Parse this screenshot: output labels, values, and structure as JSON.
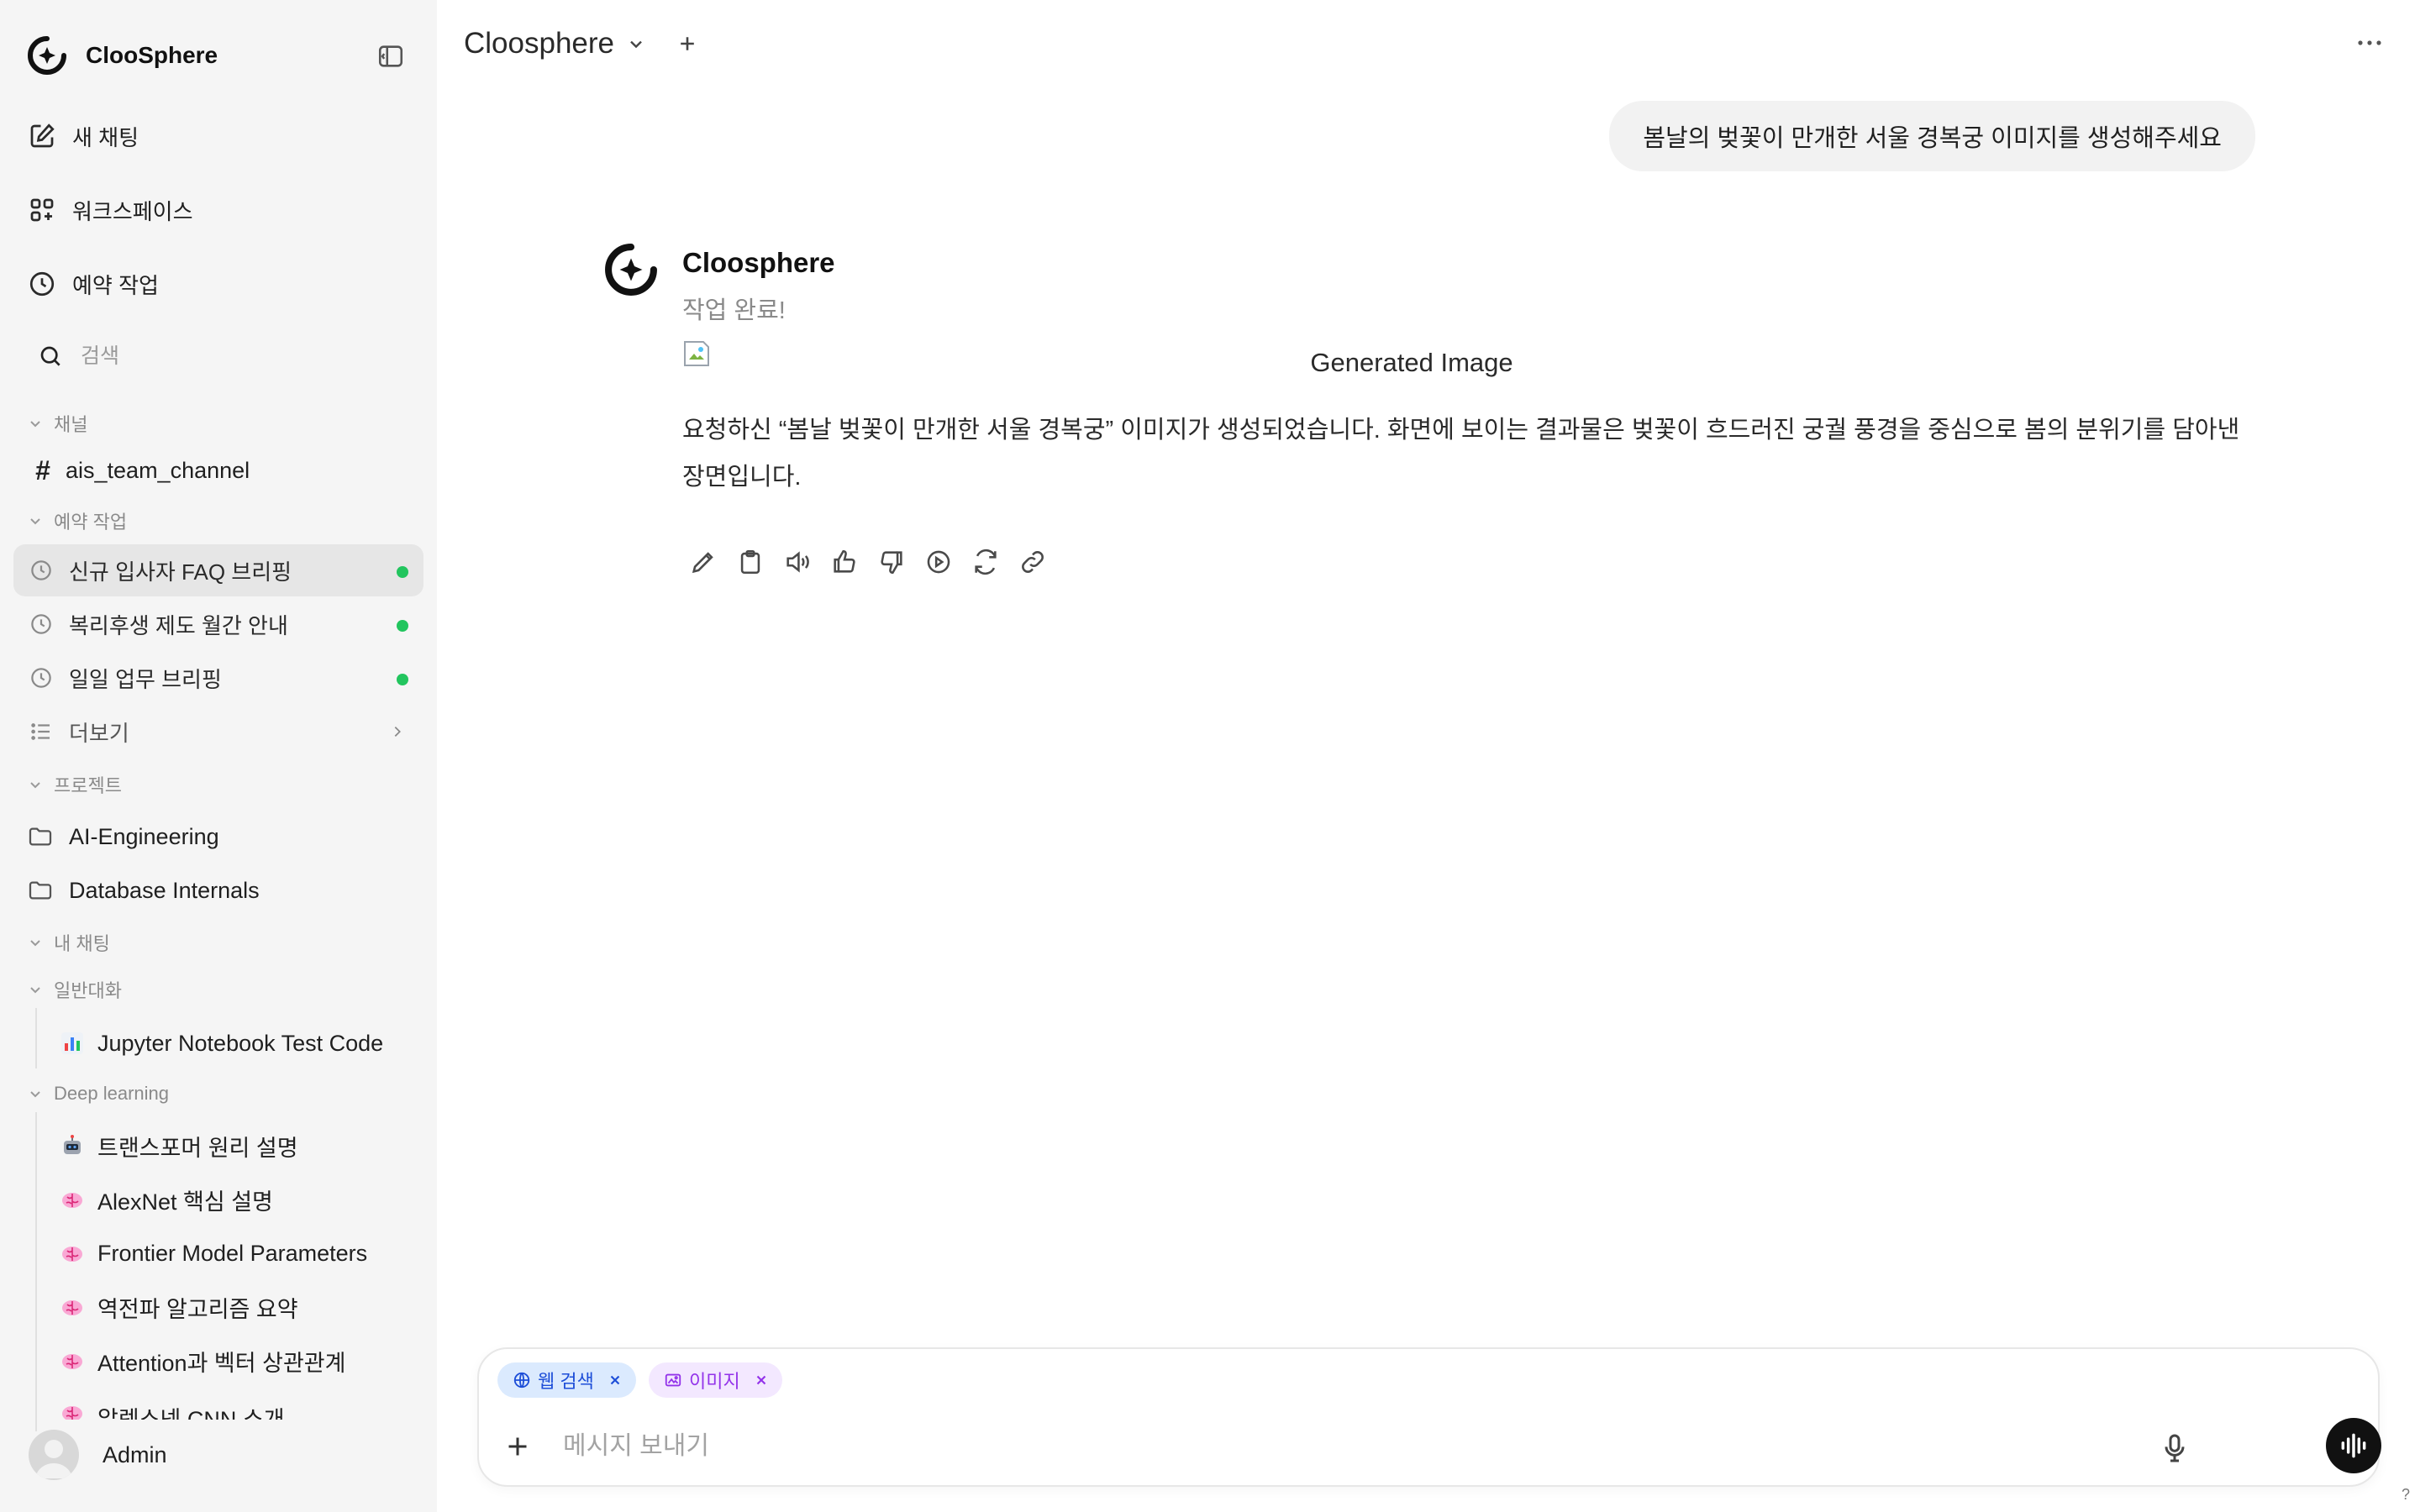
{
  "app": {
    "name": "ClooSphere"
  },
  "sidebar": {
    "nav": {
      "new_chat": "새 채팅",
      "workspace": "워크스페이스",
      "scheduled": "예약 작업"
    },
    "search_placeholder": "검색",
    "sections": {
      "channels": "채널",
      "scheduled": "예약 작업",
      "projects": "프로젝트",
      "my_chats": "내 채팅",
      "general": "일반대화",
      "deep_learning": "Deep learning"
    },
    "channels": [
      "ais_team_channel"
    ],
    "tasks": [
      {
        "label": "신규 입사자 FAQ 브리핑",
        "active": true
      },
      {
        "label": "복리후생 제도 월간 안내",
        "active": false
      },
      {
        "label": "일일 업무 브리핑",
        "active": false
      }
    ],
    "more_label": "더보기",
    "projects": [
      "AI-Engineering",
      "Database Internals"
    ],
    "general_chats": [
      {
        "emoji": "bar-chart",
        "label": "Jupyter Notebook Test Code"
      }
    ],
    "deep_learning_chats": [
      {
        "emoji": "robot",
        "label": "트랜스포머 원리 설명"
      },
      {
        "emoji": "brain",
        "label": "AlexNet 핵심 설명"
      },
      {
        "emoji": "brain",
        "label": "Frontier Model Parameters"
      },
      {
        "emoji": "brain",
        "label": "역전파 알고리즘 요약"
      },
      {
        "emoji": "brain",
        "label": "Attention과 벡터 상관관계"
      },
      {
        "emoji": "brain",
        "label": "알렉스넷 CNN 소개"
      }
    ],
    "user": {
      "name": "Admin"
    }
  },
  "header": {
    "model": "Cloosphere"
  },
  "conversation": {
    "user_message": "봄날의 벚꽃이 만개한 서울 경복궁 이미지를 생성해주세요",
    "assistant": {
      "name": "Cloosphere",
      "status": "작업 완료!",
      "image_alt": "Generated Image",
      "body": "요청하신 “봄날 벚꽃이 만개한 서울 경복궁” 이미지가 생성되었습니다. 화면에 보이는 결과물은 벚꽃이 흐드러진 궁궐 풍경을 중심으로 봄의 분위기를 담아낸 장면입니다."
    }
  },
  "composer": {
    "chips": {
      "web_search": "웹 검색",
      "image": "이미지"
    },
    "placeholder": "메시지 보내기"
  },
  "help_label": "?",
  "colors": {
    "online_dot": "#22c55e",
    "chip_web": "#1d4ed8",
    "chip_image": "#9333ea"
  }
}
